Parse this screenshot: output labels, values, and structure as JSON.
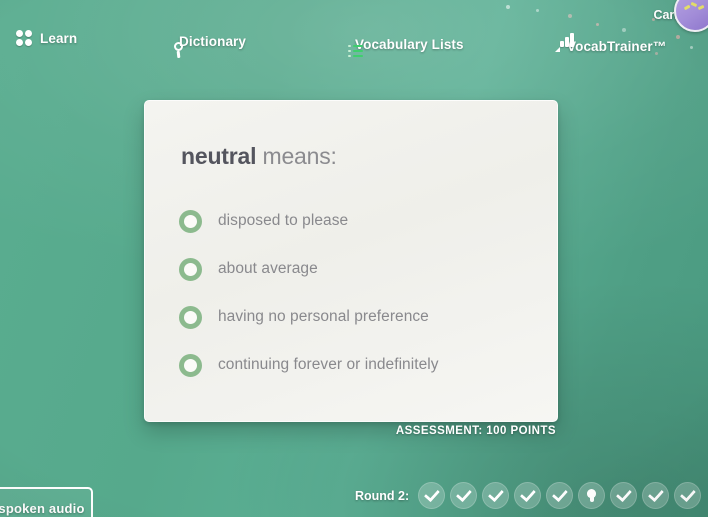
{
  "theme": {
    "background_green": "#57ab8e",
    "card_background": "#f2f2ee",
    "radio_green": "#8cba8e",
    "term_color": "#54555e",
    "muted_text": "#89898d",
    "avatar_purple": "#a58fdc",
    "list_icon_green": "#3fcf6d"
  },
  "topnav": {
    "items": [
      {
        "label": "Learn",
        "icon": "four-dots-icon"
      },
      {
        "label": "Dictionary",
        "icon": "search-icon"
      },
      {
        "label": "Vocabulary Lists",
        "icon": "list-icon"
      },
      {
        "label": "VocabTrainer™",
        "icon": "bar-chart-icon"
      }
    ]
  },
  "user": {
    "name": "Carly S.",
    "avatar_icon": "user-avatar"
  },
  "question": {
    "term": "neutral",
    "prompt_suffix": " means:",
    "choices": [
      {
        "label": "disposed to please"
      },
      {
        "label": "about average"
      },
      {
        "label": "having no personal preference"
      },
      {
        "label": "continuing forever or indefinitely"
      }
    ]
  },
  "assessment": {
    "text": "ASSESSMENT: 100 POINTS"
  },
  "footer": {
    "round_label": "Round 2:",
    "pips": [
      {
        "state": "correct",
        "icon": "check-icon"
      },
      {
        "state": "correct",
        "icon": "check-icon"
      },
      {
        "state": "correct",
        "icon": "check-icon"
      },
      {
        "state": "correct",
        "icon": "check-icon"
      },
      {
        "state": "correct",
        "icon": "check-icon"
      },
      {
        "state": "hint",
        "icon": "lightbulb-icon"
      },
      {
        "state": "correct",
        "icon": "check-icon"
      },
      {
        "state": "correct",
        "icon": "check-icon"
      },
      {
        "state": "correct",
        "icon": "check-icon"
      }
    ],
    "audio_button_label": "spoken audio"
  }
}
